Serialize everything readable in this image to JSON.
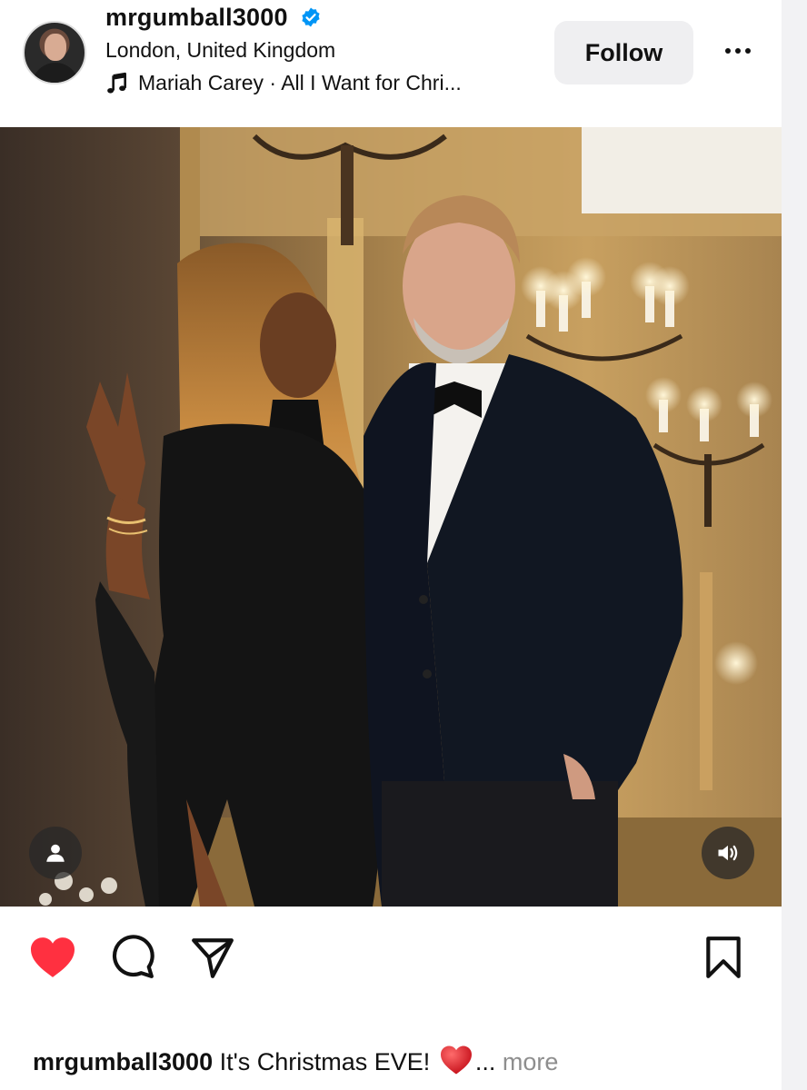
{
  "post": {
    "username": "mrgumball3000",
    "verified": true,
    "location": "London, United Kingdom",
    "audio": "Mariah Carey · All I Want for Chri...",
    "follow_label": "Follow",
    "caption": {
      "username": "mrgumball3000",
      "text": "It's Christmas EVE!",
      "ellipsis": "...",
      "more_label": "more"
    }
  },
  "icons": {
    "verified": "verified-badge-icon",
    "music": "music-note-icon",
    "more": "more-options-icon",
    "tag": "user-tag-icon",
    "sound": "speaker-icon",
    "like": "heart-icon",
    "comment": "comment-icon",
    "share": "send-icon",
    "save": "bookmark-icon"
  },
  "colors": {
    "verified": "#0095f6",
    "like_active": "#ff3040",
    "secondary_text": "#8e8e8e",
    "button_bg": "#efeff1"
  }
}
